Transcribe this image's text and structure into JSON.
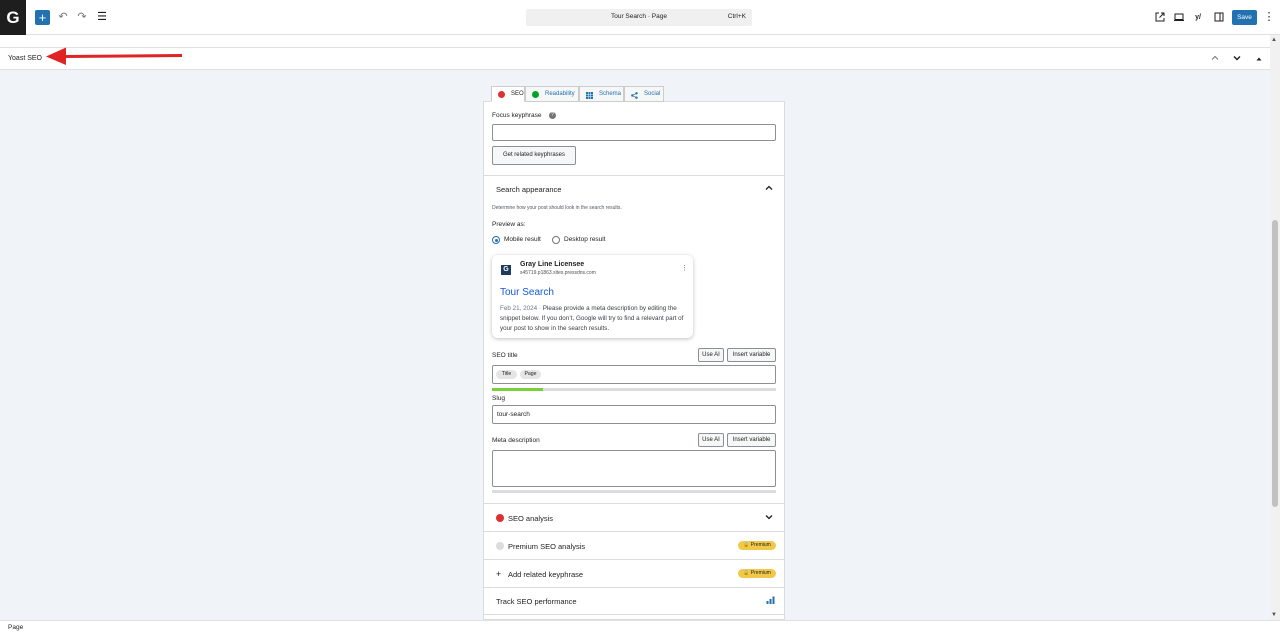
{
  "topbar": {
    "logo": "G",
    "add_label": "+",
    "command_title": "Tour Search · Page",
    "command_shortcut": "Ctrl+K",
    "save_label": "Save",
    "yoast_icon_text": "y/"
  },
  "yoast_bar": {
    "label": "Yoast SEO"
  },
  "tabs": [
    {
      "label": "SEO",
      "icon": "red-face-icon",
      "color": "#dc3232"
    },
    {
      "label": "Readability",
      "icon": "green-face-icon",
      "color": "#00a32a"
    },
    {
      "label": "Schema",
      "icon": "grid-icon",
      "color": "#2271b1"
    },
    {
      "label": "Social",
      "icon": "share-icon",
      "color": "#2271b1"
    }
  ],
  "focus": {
    "label": "Focus keyphrase",
    "help": "?",
    "value": "",
    "related_button": "Get related keyphrases"
  },
  "search_appearance": {
    "title": "Search appearance",
    "description": "Determine how your post should look in the search results.",
    "preview_label": "Preview as:",
    "options": [
      "Mobile result",
      "Desktop result"
    ],
    "selected": "Mobile result"
  },
  "serp": {
    "favicon": "G",
    "site_name": "Gray Line Licensee",
    "url": "s45719.p1863.sites.pressdns.com",
    "title": "Tour Search",
    "date": "Feb 21, 2024",
    "separator": "·",
    "description": "Please provide a meta description by editing the snippet below. If you don’t, Google will try to find a relevant part of your post to show in the search results."
  },
  "seo_title": {
    "label": "SEO title",
    "use_ai": "Use AI",
    "insert_variable": "Insert variable",
    "pills": [
      "Title",
      "Page"
    ],
    "progress": 0.18
  },
  "slug": {
    "label": "Slug",
    "value": "tour-search"
  },
  "meta_description": {
    "label": "Meta description",
    "use_ai": "Use AI",
    "insert_variable": "Insert variable",
    "value": "",
    "progress": 0
  },
  "sections": {
    "seo_analysis": "SEO analysis",
    "premium_seo": "Premium SEO analysis",
    "add_related": "Add related keyphrase",
    "track_seo": "Track SEO performance",
    "premium_badge": "Premium",
    "plus": "+"
  },
  "footer": {
    "label": "Page"
  },
  "colors": {
    "accent": "#2271b1",
    "red": "#dc3232",
    "green": "#00a32a",
    "premium": "#f0c94a"
  }
}
